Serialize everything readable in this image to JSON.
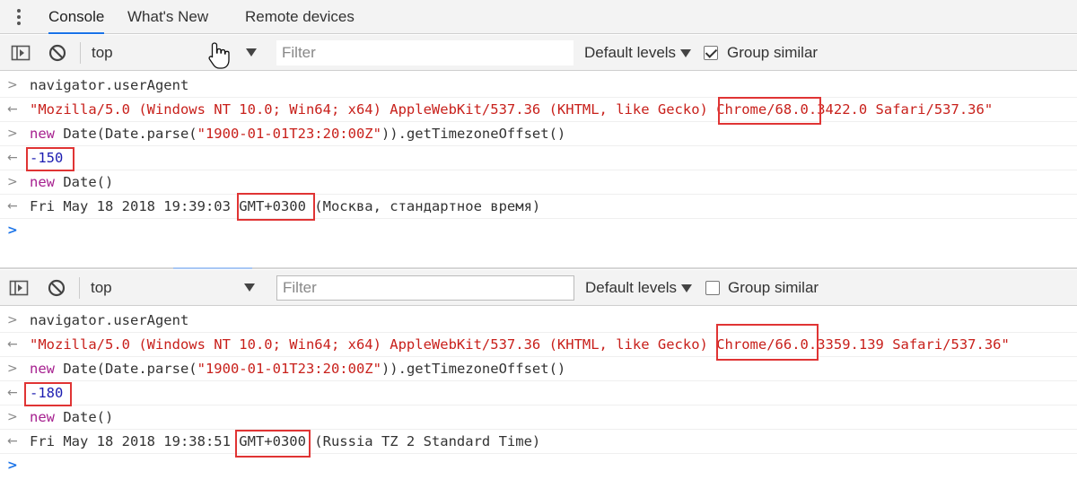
{
  "tabs": [
    {
      "label": "Console",
      "active": true
    },
    {
      "label": "What's New",
      "active": false
    },
    {
      "label": "Remote devices",
      "active": false
    }
  ],
  "icons": {
    "menu": "kebab-menu-icon",
    "sidebar": "sidebar-toggle-icon",
    "clear": "clear-console-icon",
    "cursor": "hand-cursor-icon"
  },
  "colors": {
    "highlight": "#e03434",
    "string": "#c8201b",
    "keyword": "#a6208f",
    "number": "#1c1cb1",
    "prompt": "#1a73e8"
  },
  "top_panel": {
    "toolbar": {
      "context": "top",
      "filter_placeholder": "Filter",
      "levels": "Default levels",
      "group_similar": "Group similar",
      "group_similar_checked": true
    },
    "lines": [
      {
        "type": "input",
        "text": "navigator.userAgent"
      },
      {
        "type": "output",
        "parts": [
          "\"Mozilla/5.0 (Windows NT 10.0; Win64; x64) AppleWebKit/537.36 (KHTML, like Gecko) ",
          "Chrome/68.0.",
          "3422.0 Safari/537.36\""
        ]
      },
      {
        "type": "input",
        "parts": [
          "new",
          " Date(Date.parse(",
          "\"1900-01-01T23:20:00Z\"",
          ")).getTimezoneOffset()"
        ]
      },
      {
        "type": "output",
        "text": "-150"
      },
      {
        "type": "input",
        "parts": [
          "new",
          " Date()"
        ]
      },
      {
        "type": "output",
        "parts": [
          "Fri May 18 2018 19:39:03 ",
          "GMT+0300",
          " (Москва, стандартное время)"
        ]
      },
      {
        "type": "prompt",
        "text": ""
      }
    ]
  },
  "bottom_panel": {
    "toolbar": {
      "context": "top",
      "filter_placeholder": "Filter",
      "levels": "Default levels",
      "group_similar": "Group similar",
      "group_similar_checked": false
    },
    "lines": [
      {
        "type": "input",
        "text": "navigator.userAgent"
      },
      {
        "type": "output",
        "parts": [
          "\"Mozilla/5.0 (Windows NT 10.0; Win64; x64) AppleWebKit/537.36 (KHTML, like Gecko) ",
          "Chrome/66.0.",
          "3359.139 Safari/537.36\""
        ]
      },
      {
        "type": "input",
        "parts": [
          "new",
          " Date(Date.parse(",
          "\"1900-01-01T23:20:00Z\"",
          ")).getTimezoneOffset()"
        ]
      },
      {
        "type": "output",
        "text": "-180"
      },
      {
        "type": "input",
        "parts": [
          "new",
          " Date()"
        ]
      },
      {
        "type": "output",
        "parts": [
          "Fri May 18 2018 19:38:51 ",
          "GMT+0300",
          " (Russia TZ 2 Standard Time)"
        ]
      },
      {
        "type": "prompt",
        "text": ""
      }
    ]
  }
}
